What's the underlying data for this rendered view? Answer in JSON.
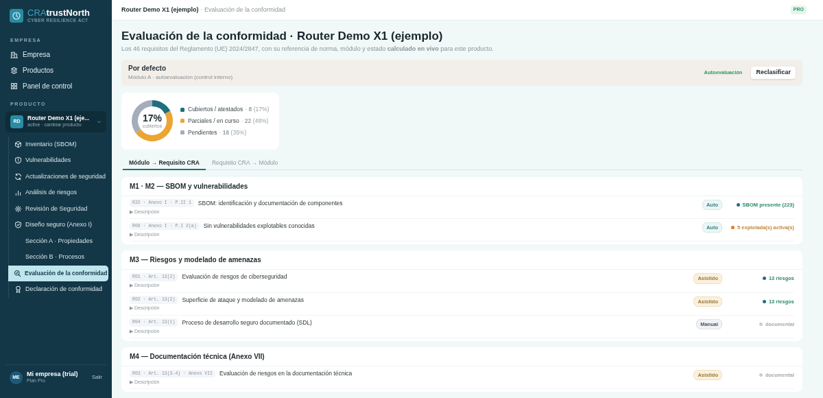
{
  "brand": {
    "part1": "CRA",
    "part2": "trustNorth",
    "tagline": "CYBER RESILIENCE ACT"
  },
  "sidebar": {
    "company_label": "EMPRESA",
    "company_items": [
      {
        "label": "Empresa",
        "kind": "building"
      },
      {
        "label": "Productos",
        "kind": "layers"
      },
      {
        "label": "Panel de control",
        "kind": "grid"
      }
    ],
    "product_label": "PRODUCTO",
    "product": {
      "initials": "RD",
      "name": "Router Demo X1 (eje...",
      "sub": "active · cambiar producto"
    },
    "product_items": [
      {
        "label": "Inventario (SBOM)",
        "kind": "box",
        "selected": false
      },
      {
        "label": "Vulnerabilidades",
        "kind": "shield-alert",
        "selected": false
      },
      {
        "label": "Actualizaciones de seguridad",
        "kind": "refresh",
        "selected": false
      },
      {
        "label": "Análisis de riesgos",
        "kind": "bars",
        "selected": false
      },
      {
        "label": "Revisión de Seguridad",
        "kind": "gear",
        "selected": false
      },
      {
        "label": "Diseño seguro (Anexo I)",
        "kind": "shield-check",
        "selected": false,
        "children": [
          {
            "label": "Sección A · Propiedades",
            "selected": false
          },
          {
            "label": "Sección B · Procesos",
            "selected": false
          }
        ]
      },
      {
        "label": "Evaluación de la conformidad",
        "kind": "search-check",
        "selected": true
      },
      {
        "label": "Declaración de conformidad",
        "kind": "award",
        "selected": false
      }
    ],
    "user": {
      "initials": "ME",
      "name": "Mi empresa (trial)",
      "plan": "Plan Pro",
      "logout": "Salir"
    }
  },
  "header": {
    "product": "Router Demo X1 (ejemplo)",
    "page": "· Evaluación de la conformidad",
    "badge": "PRO"
  },
  "title": "Evaluación de la conformidad · Router Demo X1 (ejemplo)",
  "subtitle": "Los 46 requisitos del Reglamento (UE) 2024/2847, con su referencia de norma, módulo y estado **calculado en vivo** para este producto.",
  "classification": {
    "title": "Por defecto",
    "sub": "Módulo A · autoevaluación (control interno)",
    "status": "Autoevaluación",
    "button": "Reclasificar"
  },
  "summary": {
    "center": "17%",
    "center_label": "cubiertos",
    "legend": [
      {
        "color": "#1f6f80",
        "detail": "· **8** (17%)"
      },
      {
        "color": "#eba533",
        "detail": "· **22** (48%)"
      },
      {
        "color": "#a3adbb",
        "detail": "· **16** (35%)"
      }
    ],
    "chart_data": {
      "type": "donut",
      "categories": [
        "Cubiertos / atestados",
        "Parciales / en curso",
        "Pendientes"
      ],
      "values": [
        17,
        48,
        35
      ]
    }
  },
  "tabs": [
    {
      "label": "Módulo → Requisito CRA",
      "selected": true
    },
    {
      "label": "Requisito CRA → Módulo",
      "selected": false
    }
  ],
  "groups": [
    {
      "title": "M1 · M2 — SBOM y vulnerabilidades",
      "rows": [
        {
          "ref": "R22 · Anexo I · P.II 1",
          "title": "SBOM: identificación y documentación de componentes",
          "toggle": "▶ Descripción",
          "mode": {
            "label": "Auto",
            "kind": "auto"
          },
          "status": {
            "text": "SBOM presente (223)",
            "kind": "ok",
            "color": "#1f6f80"
          }
        },
        {
          "ref": "R09 · Anexo I · P.I 2(a)",
          "title": "Sin vulnerabilidades explotables conocidas",
          "toggle": "▶ Descripción",
          "mode": {
            "label": "Auto",
            "kind": "auto"
          },
          "status": {
            "text": "5 explotada(s) activa(s)",
            "kind": "warn",
            "color": "#e07b1f"
          }
        }
      ]
    },
    {
      "title": "M3 — Riesgos y modelado de amenazas",
      "rows": [
        {
          "ref": "R01 · Art. 13(2)",
          "title": "Evaluación de riesgos de ciberseguridad",
          "toggle": "▶ Descripción",
          "mode": {
            "label": "Asistido",
            "kind": "assisted"
          },
          "status": {
            "text": "13 riesgos",
            "kind": "ok",
            "color": "#1f6f80"
          }
        },
        {
          "ref": "R02 · Art. 13(2)",
          "title": "Superficie de ataque y modelado de amenazas",
          "toggle": "▶ Descripción",
          "mode": {
            "label": "Asistido",
            "kind": "assisted"
          },
          "status": {
            "text": "13 riesgos",
            "kind": "ok",
            "color": "#1f6f80"
          }
        },
        {
          "ref": "R04 · Art. 13(1)",
          "title": "Proceso de desarrollo seguro documentado (SDL)",
          "toggle": "▶ Descripción",
          "mode": {
            "label": "Manual",
            "kind": "manual"
          },
          "status": {
            "text": "documental",
            "kind": "pending",
            "color": "#c8cdd3"
          }
        }
      ]
    },
    {
      "title": "M4 — Documentación técnica (Anexo VII)",
      "rows": [
        {
          "ref": "R03 · Art. 13(3-4) · Anexo VII",
          "title": "Evaluación de riesgos en la documentación técnica",
          "toggle": "▶ Descripción",
          "mode": {
            "label": "Asistido",
            "kind": "assisted"
          },
          "status": {
            "text": "documental",
            "kind": "pending",
            "color": "#c8cdd3"
          }
        }
      ]
    }
  ]
}
